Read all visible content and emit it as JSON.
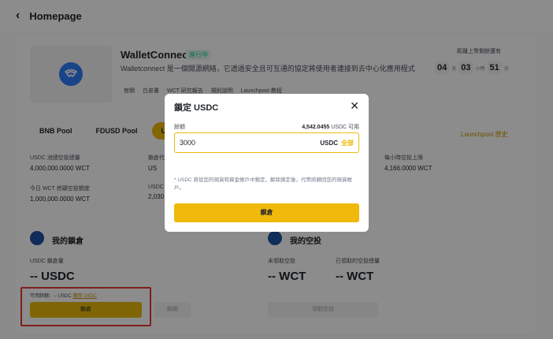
{
  "header": {
    "back_icon": "chevron-left-icon",
    "title": "Homepage"
  },
  "project": {
    "name": "WalletConnect",
    "badge": "進行中",
    "description": "Walletconnect 是一個開源網絡，它透過安全且可互通的協定將使用者連接到去中心化應用程式",
    "links": [
      "官網",
      "白皮書",
      "WCT 研究報告",
      "規則說明",
      "Launchpool 教程"
    ]
  },
  "countdown": {
    "label": "距離上幣剩餘還有",
    "days": "04",
    "days_unit": "天",
    "hours": "03",
    "hours_unit": "小時",
    "minutes": "51",
    "minutes_unit": "分"
  },
  "pools": {
    "tabs": [
      "BNB Pool",
      "FDUSD Pool",
      "USDC"
    ],
    "active_index": 2,
    "history": "Launchpool 歷史"
  },
  "stats": [
    {
      "label": "USDC 池總空投總量",
      "value": "4,000,000.0000 WCT"
    },
    {
      "label": "鎖倉代",
      "value": "US"
    },
    {
      "label": "每小時空投上限",
      "value": "4,166.0000 WCT"
    },
    {
      "label": "今日 WCT 挖礦空投額度",
      "value": "1,000,000.0000 WCT"
    },
    {
      "label": "USDC",
      "value": "2,030"
    }
  ],
  "my_lock": {
    "title": "我的鎖倉",
    "lock_label": "USDC 鎖倉量",
    "lock_value": "-- USDC",
    "available_label": "可用餘額：-- USDC",
    "buy_link": "購買 USDC",
    "lock_button": "鎖倉",
    "unlock_button": "解鎖"
  },
  "my_airdrop": {
    "title": "我的空投",
    "unclaimed_label": "未領取空投",
    "unclaimed_value": "-- WCT",
    "claimed_label": "已領取的空投總量",
    "claimed_value": "-- WCT",
    "claim_button": "領取空投"
  },
  "modal": {
    "title": "鎖定 USDC",
    "amount_label": "餘額",
    "available_value": "4,542.0455",
    "available_suffix": "USDC 可用",
    "input_value": "3000",
    "unit": "USDC",
    "max_label": "全部",
    "note": "* USDC 將從您的現貨和資金帳戶中鎖定，解除鎖定後，代幣將歸回您的現貨帳戶。",
    "confirm": "鎖倉"
  },
  "colors": {
    "accent": "#f0b90b",
    "highlight_frame": "#e53935",
    "brand_blue": "#2f7cf6"
  }
}
